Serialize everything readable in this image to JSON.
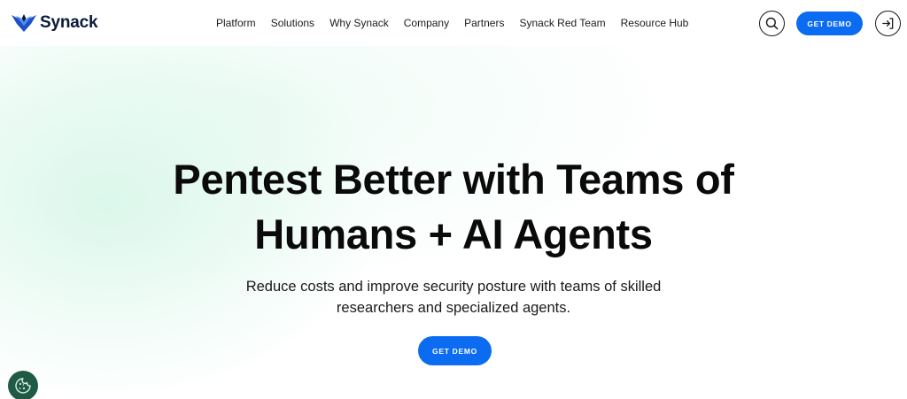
{
  "header": {
    "logo_text": "Synack",
    "nav": [
      {
        "label": "Platform",
        "name": "nav-platform"
      },
      {
        "label": "Solutions",
        "name": "nav-solutions"
      },
      {
        "label": "Why Synack",
        "name": "nav-why-synack"
      },
      {
        "label": "Company",
        "name": "nav-company"
      },
      {
        "label": "Partners",
        "name": "nav-partners"
      },
      {
        "label": "Synack Red Team",
        "name": "nav-synack-red-team"
      },
      {
        "label": "Resource Hub",
        "name": "nav-resource-hub"
      }
    ],
    "demo_label": "GET DEMO",
    "icons": {
      "search": "search-icon",
      "login": "login-icon"
    }
  },
  "hero": {
    "title_line1": "Pentest Better with Teams of",
    "title_line2": "Humans + AI Agents",
    "subtitle_line1": "Reduce costs and improve security posture with teams of skilled",
    "subtitle_line2": "researchers and specialized agents.",
    "cta_label": "GET DEMO"
  },
  "cookie": {
    "icon": "cookie-icon"
  },
  "colors": {
    "accent": "#0b6cf2",
    "cookie_bg": "#1f5a45",
    "logo_blue": "#1e4fc9",
    "text": "#0a0a0a"
  }
}
